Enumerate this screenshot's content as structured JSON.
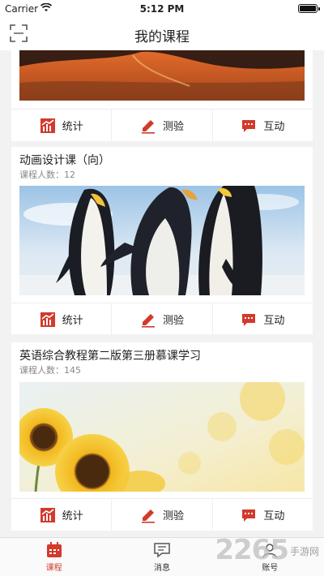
{
  "status_bar": {
    "carrier": "Carrier",
    "time": "5:12 PM"
  },
  "nav": {
    "title": "我的课程"
  },
  "colors": {
    "accent": "#d23a2c"
  },
  "courses": [
    {
      "title": "",
      "count_label": "",
      "count": "",
      "image": "mountain-sunset"
    },
    {
      "title": "动画设计课（向）",
      "count_label": "课程人数：",
      "count": "12",
      "image": "penguins"
    },
    {
      "title": "英语综合教程第二版第三册慕课学习",
      "count_label": "课程人数：",
      "count": "145",
      "image": "sunflowers"
    }
  ],
  "actions": {
    "stats": "统计",
    "quiz": "测验",
    "interact": "互动"
  },
  "tabs": [
    {
      "label": "课程",
      "icon": "calendar-icon",
      "active": true
    },
    {
      "label": "消息",
      "icon": "message-icon",
      "active": false
    },
    {
      "label": "账号",
      "icon": "user-icon",
      "active": false
    }
  ],
  "watermark": {
    "brand": "2265",
    "suffix": "手游网"
  }
}
